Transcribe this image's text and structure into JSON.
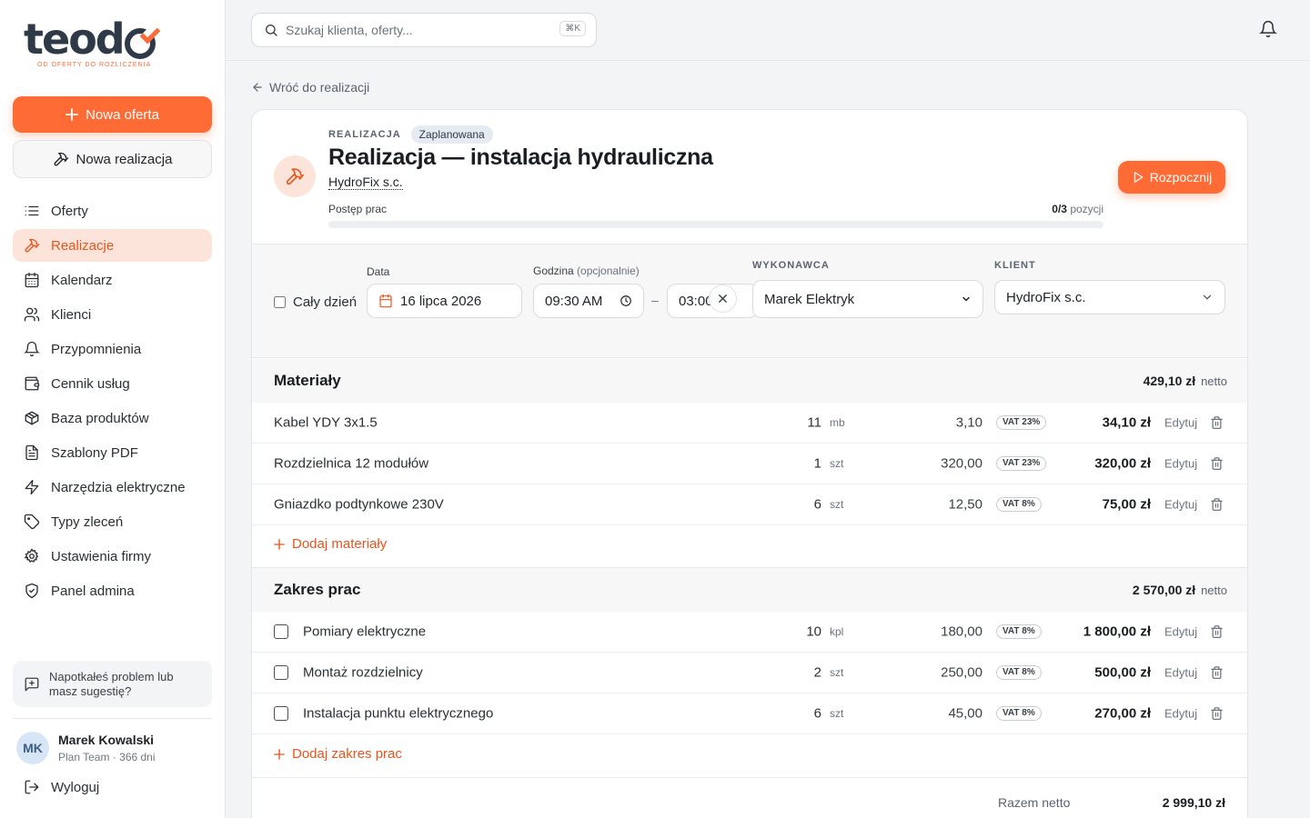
{
  "brand": {
    "logo_name": "teodo",
    "tagline": "OD OFERTY DO ROZLICZENIA",
    "accent": "#ff6b35"
  },
  "sidebar": {
    "new_offer": "Nowa oferta",
    "new_realization": "Nowa realizacja",
    "items": [
      {
        "label": "Oferty",
        "icon": "list-icon",
        "active": false
      },
      {
        "label": "Realizacje",
        "icon": "hammer-icon",
        "active": true
      },
      {
        "label": "Kalendarz",
        "icon": "calendar-icon",
        "active": false
      },
      {
        "label": "Klienci",
        "icon": "users-icon",
        "active": false
      },
      {
        "label": "Przypomnienia",
        "icon": "bell-icon",
        "active": false
      },
      {
        "label": "Cennik usług",
        "icon": "wallet-icon",
        "active": false
      },
      {
        "label": "Baza produktów",
        "icon": "box-icon",
        "active": false
      },
      {
        "label": "Szablony PDF",
        "icon": "file-icon",
        "active": false
      },
      {
        "label": "Narzędzia elektryczne",
        "icon": "zap-icon",
        "active": false
      },
      {
        "label": "Typy zleceń",
        "icon": "tag-icon",
        "active": false
      },
      {
        "label": "Ustawienia firmy",
        "icon": "gear-icon",
        "active": false
      },
      {
        "label": "Panel admina",
        "icon": "shield-icon",
        "active": false
      }
    ],
    "feedback": "Napotkałeś problem lub masz sugestię?",
    "user": {
      "initials": "MK",
      "name": "Marek Kowalski",
      "plan": "Plan Team · 366 dni"
    },
    "logout": "Wyloguj"
  },
  "topbar": {
    "search_placeholder": "Szukaj klienta, oferty...",
    "shortcut": "⌘K"
  },
  "main": {
    "back": "Wróć do realizacji",
    "eyebrow": "REALIZACJA",
    "status": "Zaplanowana",
    "title": "Realizacja — instalacja hydrauliczna",
    "client": "HydroFix s.c.",
    "progress_label": "Postęp prac",
    "progress_done": "0/3",
    "progress_suffix": "pozycji",
    "progress_fraction": 0,
    "start_button": "Rozpocznij",
    "schedule": {
      "all_day": "Cały dzień",
      "date_label": "Data",
      "date_value": "16 lipca 2026",
      "time_label": "Godzina",
      "time_optional": "(opcjonalnie)",
      "time_start": "09:30 AM",
      "time_end": "03:00",
      "contractor_label": "WYKONAWCA",
      "contractor_value": "Marek Elektryk",
      "client_label": "KLIENT",
      "client_value": "HydroFix s.c."
    },
    "materials": {
      "title": "Materiały",
      "total": "429,10 zł",
      "net": "netto",
      "rows": [
        {
          "name": "Kabel YDY 3x1.5",
          "qty": "11",
          "unit": "mb",
          "price": "3,10",
          "vat": "VAT 23%",
          "total": "34,10 zł"
        },
        {
          "name": "Rozdzielnica 12 modułów",
          "qty": "1",
          "unit": "szt",
          "price": "320,00",
          "vat": "VAT 23%",
          "total": "320,00 zł"
        },
        {
          "name": "Gniazdko podtynkowe 230V",
          "qty": "6",
          "unit": "szt",
          "price": "12,50",
          "vat": "VAT 8%",
          "total": "75,00 zł"
        }
      ],
      "add": "Dodaj materiały"
    },
    "works": {
      "title": "Zakres prac",
      "total": "2 570,00 zł",
      "net": "netto",
      "rows": [
        {
          "name": "Pomiary elektryczne",
          "qty": "10",
          "unit": "kpl",
          "price": "180,00",
          "vat": "VAT 8%",
          "total": "1 800,00 zł"
        },
        {
          "name": "Montaż rozdzielnicy",
          "qty": "2",
          "unit": "szt",
          "price": "250,00",
          "vat": "VAT 8%",
          "total": "500,00 zł"
        },
        {
          "name": "Instalacja punktu elektrycznego",
          "qty": "6",
          "unit": "szt",
          "price": "45,00",
          "vat": "VAT 8%",
          "total": "270,00 zł"
        }
      ],
      "add": "Dodaj zakres prac"
    },
    "edit": "Edytuj",
    "summary": {
      "label": "Razem netto",
      "value": "2 999,10 zł"
    }
  }
}
